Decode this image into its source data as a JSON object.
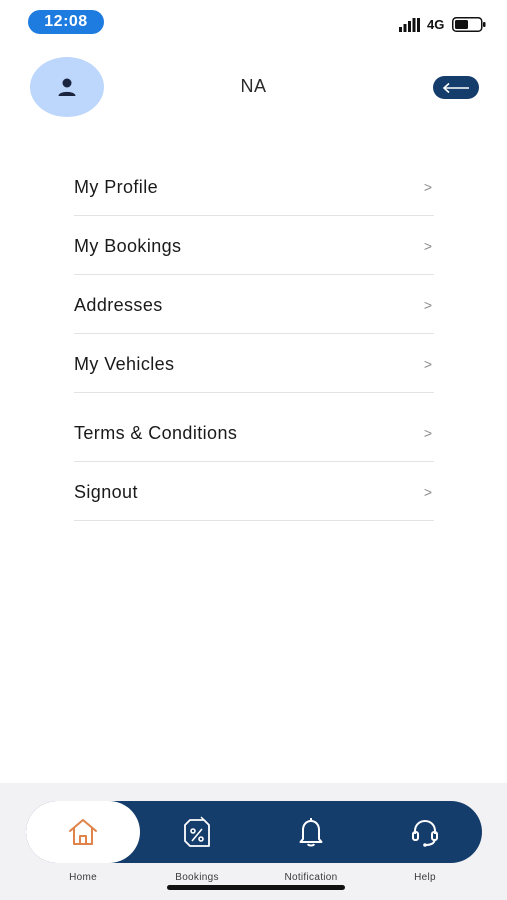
{
  "status_bar": {
    "time": "12:08",
    "network": "4G",
    "signal_icon": "signal-bars-icon",
    "battery_icon": "battery-icon"
  },
  "header": {
    "avatar_icon": "user-icon",
    "name": "NA",
    "back_icon": "arrow-left-icon"
  },
  "menu": {
    "items": [
      {
        "label": "My Profile",
        "chevron": ">"
      },
      {
        "label": "My Bookings",
        "chevron": ">"
      },
      {
        "label": "Addresses",
        "chevron": ">"
      },
      {
        "label": "My Vehicles",
        "chevron": ">"
      },
      {
        "label": "Terms & Conditions",
        "chevron": ">"
      },
      {
        "label": "Signout",
        "chevron": ">"
      }
    ]
  },
  "bottom_nav": {
    "items": [
      {
        "label": "Home",
        "icon": "home-icon"
      },
      {
        "label": "Bookings",
        "icon": "discount-tag-icon"
      },
      {
        "label": "Notification",
        "icon": "bell-icon"
      },
      {
        "label": "Help",
        "icon": "headset-icon"
      }
    ]
  },
  "colors": {
    "primary": "#153d6b",
    "time_pill": "#1e7be0",
    "avatar_bg": "#bcd7fb",
    "home_icon": "#e0834a"
  }
}
